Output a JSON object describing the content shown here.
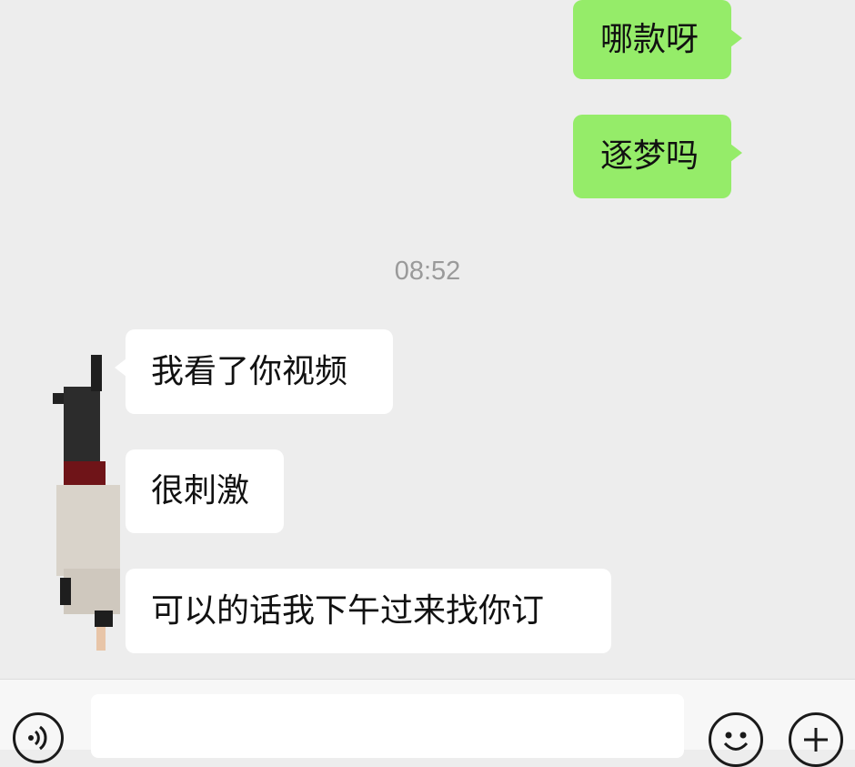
{
  "messages": {
    "outgoing_1": "哪款呀",
    "outgoing_2": "逐梦吗",
    "timestamp": "08:52",
    "incoming_1": "我看了你视频",
    "incoming_2": "很刺激",
    "incoming_3": "可以的话我下午过来找你订"
  },
  "icons": {
    "voice": "voice-icon",
    "emoji": "emoji-icon",
    "plus": "plus-icon"
  },
  "colors": {
    "outgoing_bubble": "#95ec69",
    "incoming_bubble": "#ffffff",
    "background": "#ededed"
  }
}
